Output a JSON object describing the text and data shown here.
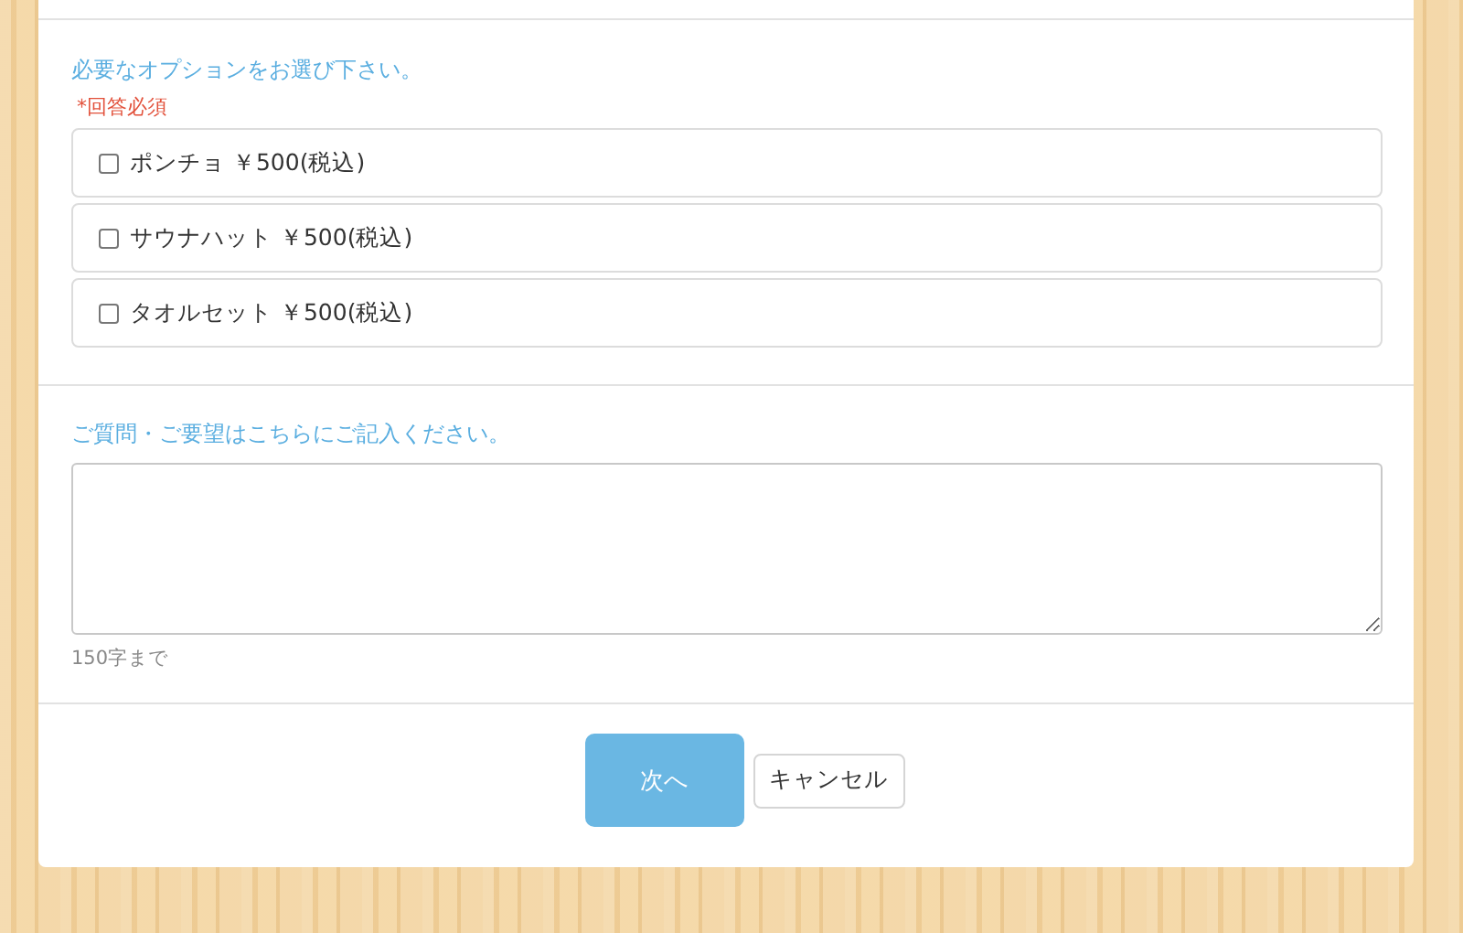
{
  "options_section": {
    "title": "必要なオプションをお選び下さい。",
    "required_note": "*回答必須",
    "options": [
      {
        "label": "ポンチョ ￥500(税込)",
        "checked": false
      },
      {
        "label": "サウナハット ￥500(税込)",
        "checked": false
      },
      {
        "label": "タオルセット ￥500(税込)",
        "checked": false
      }
    ]
  },
  "comment_section": {
    "label": "ご質問・ご要望はこちらにご記入ください。",
    "hint": "150字まで"
  },
  "buttons": [
    {
      "label": "次へ",
      "kind": "primary"
    },
    {
      "label": "キャンセル",
      "kind": "secondary"
    }
  ]
}
